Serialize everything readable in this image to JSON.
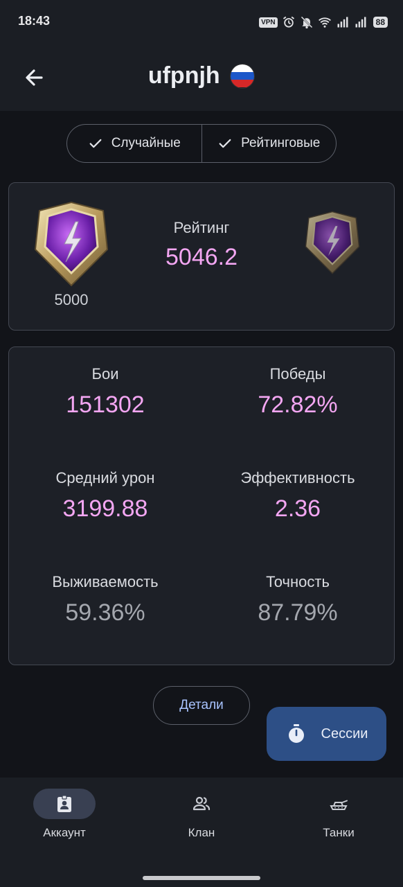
{
  "status_bar": {
    "time": "18:43",
    "vpn": "VPN",
    "battery": "88",
    "icons": [
      "alarm-icon",
      "bell-off-icon",
      "wifi-icon",
      "signal-icon",
      "signal-icon"
    ]
  },
  "app_bar": {
    "title": "ufpnjh",
    "back_icon": "arrow-left-icon",
    "flag": "russia-flag"
  },
  "filters": [
    {
      "label": "Случайные",
      "checked": true
    },
    {
      "label": "Рейтинговые",
      "checked": true
    }
  ],
  "rating": {
    "rank_value": "5000",
    "label": "Рейтинг",
    "value": "5046.2"
  },
  "stats": [
    {
      "label": "Бои",
      "value": "151302",
      "color": "#f3a6f2"
    },
    {
      "label": "Победы",
      "value": "72.82%",
      "color": "#f3a6f2"
    },
    {
      "label": "Средний урон",
      "value": "3199.88",
      "color": "#f3a6f2"
    },
    {
      "label": "Эффективность",
      "value": "2.36",
      "color": "#f3a6f2"
    },
    {
      "label": "Выживаемость",
      "value": "59.36%",
      "color": "#a4a7ae"
    },
    {
      "label": "Точность",
      "value": "87.79%",
      "color": "#a4a7ae"
    }
  ],
  "details_button": "Детали",
  "fab": {
    "label": "Сессии",
    "icon": "stopwatch-icon"
  },
  "bottom_nav": [
    {
      "label": "Аккаунт",
      "icon": "account-badge-icon",
      "active": true
    },
    {
      "label": "Клан",
      "icon": "group-icon",
      "active": false
    },
    {
      "label": "Танки",
      "icon": "tank-icon",
      "active": false
    }
  ],
  "colors": {
    "accent_pink": "#f3a6f2",
    "muted_value": "#a4a7ae",
    "fab_bg": "#2d4f86",
    "link_blue": "#a9c4ff"
  }
}
